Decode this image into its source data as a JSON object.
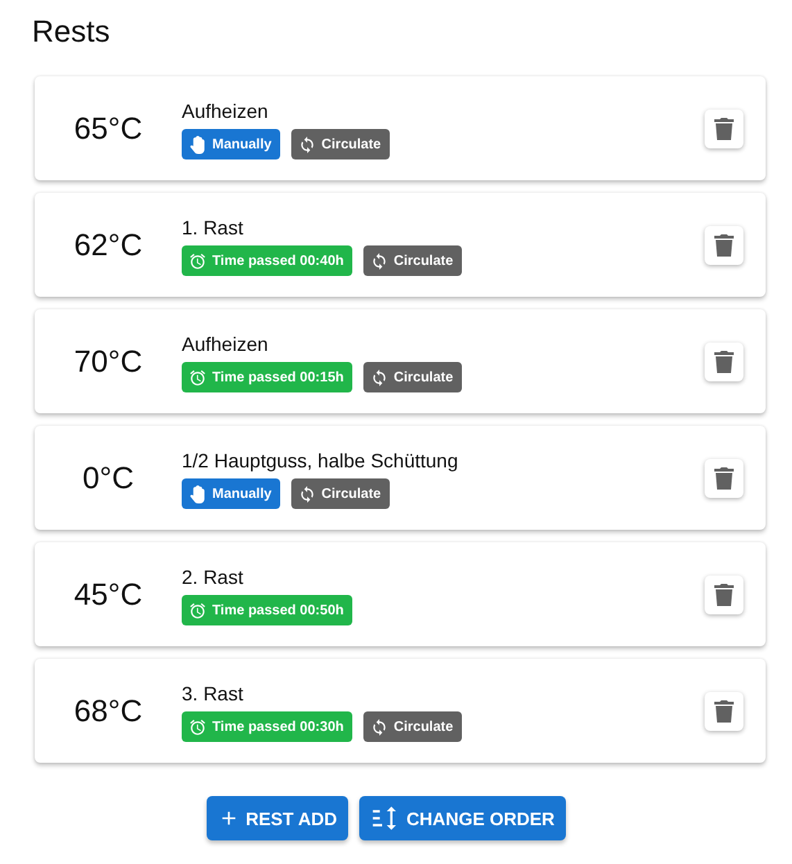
{
  "title": "Rests",
  "rests": [
    {
      "temperature": "65°C",
      "name": "Aufheizen",
      "chips": [
        {
          "kind": "manual",
          "label": "Manually"
        },
        {
          "kind": "circulate",
          "label": "Circulate"
        }
      ]
    },
    {
      "temperature": "62°C",
      "name": "1. Rast",
      "chips": [
        {
          "kind": "timer",
          "label": "Time passed 00:40h"
        },
        {
          "kind": "circulate",
          "label": "Circulate"
        }
      ]
    },
    {
      "temperature": "70°C",
      "name": "Aufheizen",
      "chips": [
        {
          "kind": "timer",
          "label": "Time passed 00:15h"
        },
        {
          "kind": "circulate",
          "label": "Circulate"
        }
      ]
    },
    {
      "temperature": "0°C",
      "name": "1/2 Hauptguss, halbe Schüttung",
      "chips": [
        {
          "kind": "manual",
          "label": "Manually"
        },
        {
          "kind": "circulate",
          "label": "Circulate"
        }
      ]
    },
    {
      "temperature": "45°C",
      "name": "2. Rast",
      "chips": [
        {
          "kind": "timer",
          "label": "Time passed 00:50h"
        }
      ]
    },
    {
      "temperature": "68°C",
      "name": "3. Rast",
      "chips": [
        {
          "kind": "timer",
          "label": "Time passed 00:30h"
        },
        {
          "kind": "circulate",
          "label": "Circulate"
        }
      ]
    }
  ],
  "buttons": [
    {
      "kind": "add",
      "label": "REST ADD"
    },
    {
      "kind": "order",
      "label": "CHANGE ORDER"
    }
  ]
}
